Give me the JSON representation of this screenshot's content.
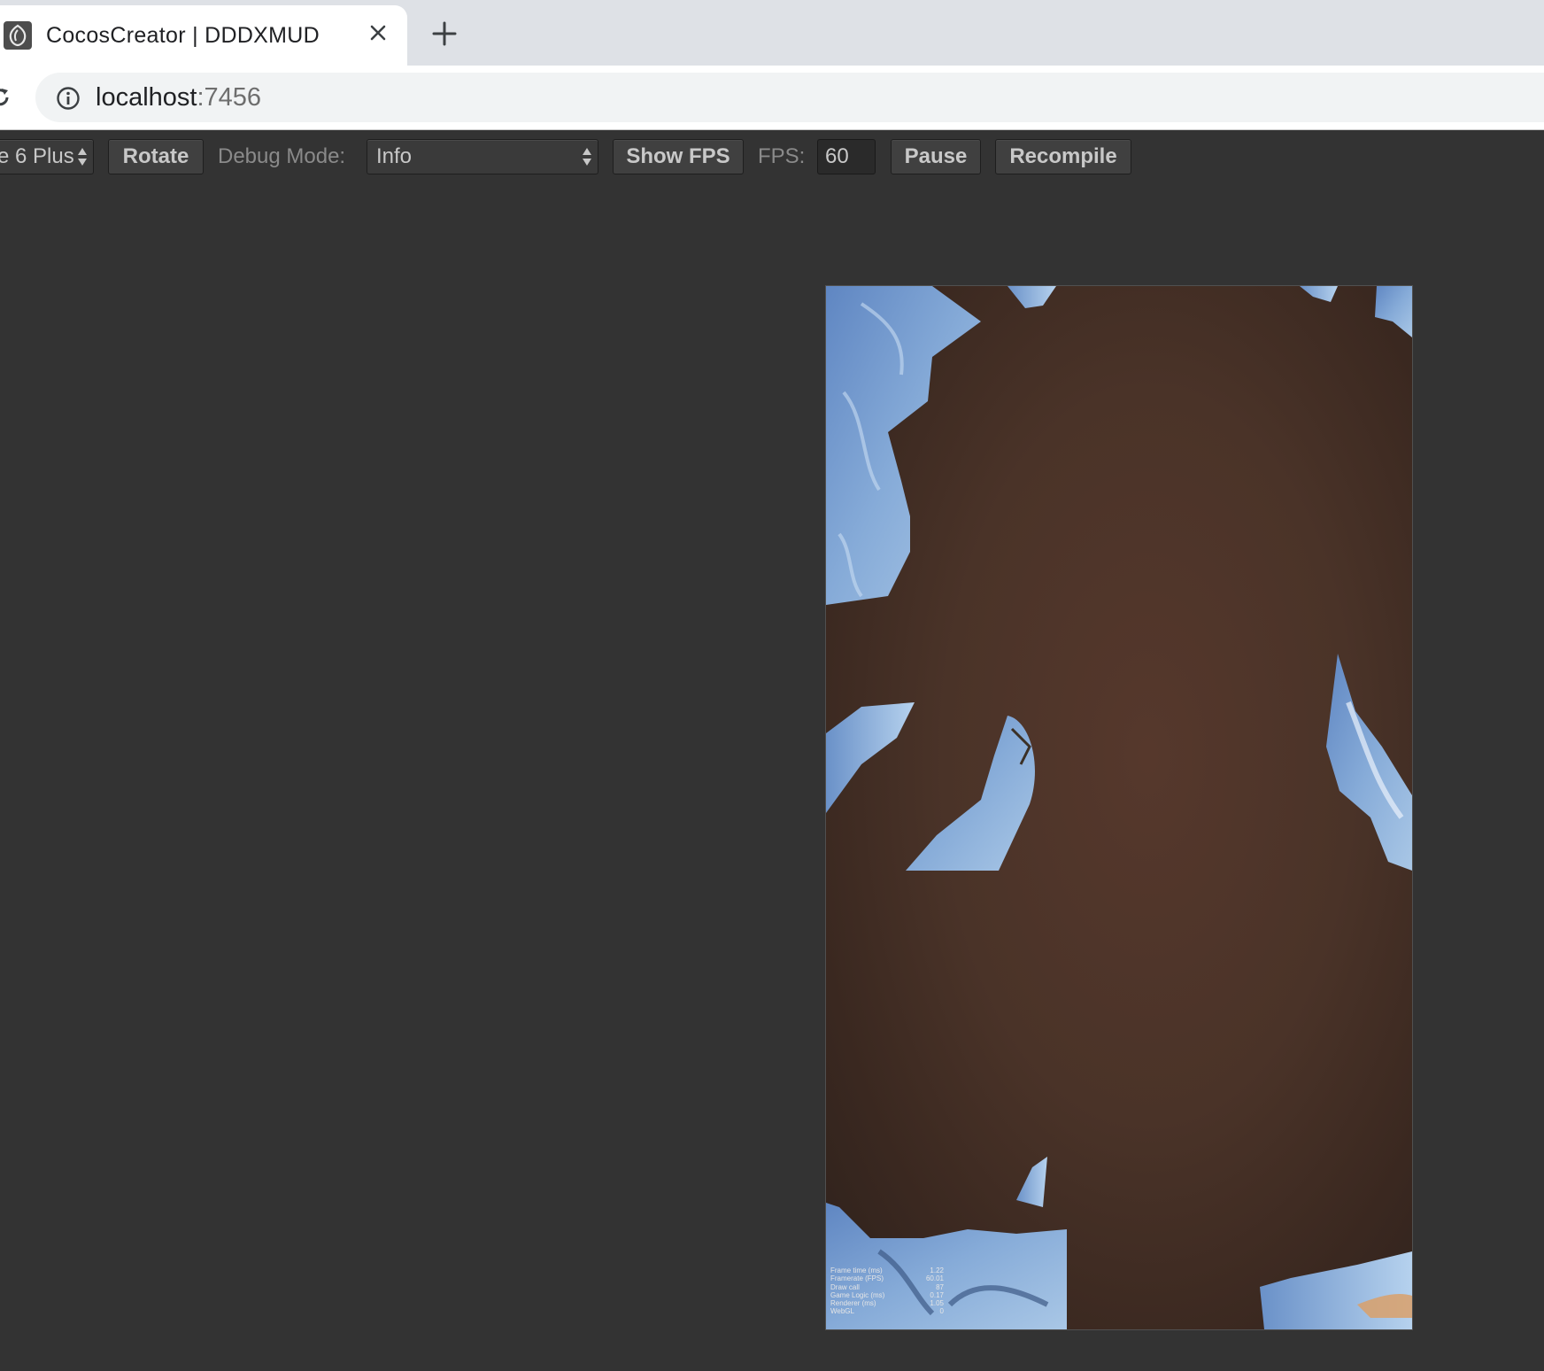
{
  "browser": {
    "tab_title": "CocosCreator | DDDXMUD",
    "favicon": "cocos-creator-icon",
    "url_host": "localhost",
    "url_port": ":7456"
  },
  "preview_toolbar": {
    "device_select_value": "e 6 Plus",
    "rotate_label": "Rotate",
    "debug_mode_label": "Debug Mode:",
    "debug_mode_value": "Info",
    "show_fps_label": "Show FPS",
    "fps_label": "FPS:",
    "fps_value": "60",
    "pause_label": "Pause",
    "recompile_label": "Recompile"
  },
  "stats_panel": {
    "rows": [
      {
        "label": "Frame time (ms)",
        "value": "1.22"
      },
      {
        "label": "Framerate (FPS)",
        "value": "60.01"
      },
      {
        "label": "Draw call",
        "value": "87"
      },
      {
        "label": "Game Logic (ms)",
        "value": "0.17"
      },
      {
        "label": "Renderer (ms)",
        "value": "1.05"
      },
      {
        "label": "WebGL",
        "value": "0"
      }
    ]
  },
  "colors": {
    "page_background": "#333333",
    "scene_brown": "#4a3328",
    "scene_blue": "#7aa3d6"
  }
}
